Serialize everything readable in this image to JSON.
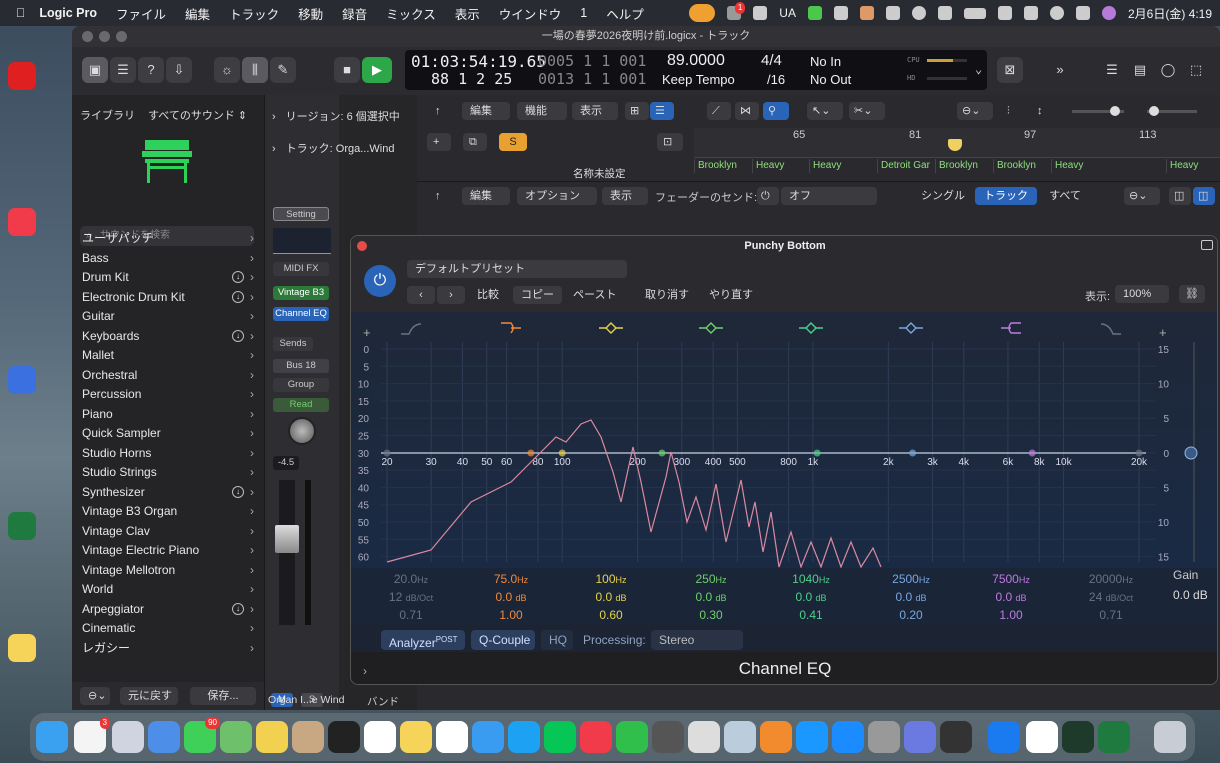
{
  "menubar": {
    "app": "Logic Pro",
    "items": [
      "ファイル",
      "編集",
      "トラック",
      "移動",
      "録音",
      "ミックス",
      "表示",
      "ウインドウ",
      "1",
      "ヘルプ"
    ],
    "ua": "UA",
    "datetime": "2月6日(金)  4:19",
    "notif_badge": "1"
  },
  "window": {
    "title": "一場の春夢2026夜明け前.logicx - トラック"
  },
  "lcd": {
    "smpte": "01:03:54:19.65",
    "bars_top": "0005  1  1  001",
    "tempo": "89.0000",
    "signature": "4/4",
    "in": "No In",
    "bars": "88  1  2  25",
    "bars_bottom": "0013  1  1  001",
    "tempo_mode": "Keep Tempo",
    "division": "/16",
    "out": "No Out",
    "cpu": "CPU",
    "hd": "HD"
  },
  "library": {
    "title": "ライブラリ",
    "filter": "すべてのサウンド ⇕",
    "search_placeholder": "サウンドを検索",
    "items": [
      {
        "label": "ユーザパッチ",
        "dl": false
      },
      {
        "label": "Bass",
        "dl": false
      },
      {
        "label": "Drum Kit",
        "dl": true
      },
      {
        "label": "Electronic Drum Kit",
        "dl": true
      },
      {
        "label": "Guitar",
        "dl": false
      },
      {
        "label": "Keyboards",
        "dl": true
      },
      {
        "label": "Mallet",
        "dl": false
      },
      {
        "label": "Orchestral",
        "dl": false
      },
      {
        "label": "Percussion",
        "dl": false
      },
      {
        "label": "Piano",
        "dl": false
      },
      {
        "label": "Quick Sampler",
        "dl": false
      },
      {
        "label": "Studio Horns",
        "dl": false
      },
      {
        "label": "Studio Strings",
        "dl": false
      },
      {
        "label": "Synthesizer",
        "dl": true
      },
      {
        "label": "Vintage B3 Organ",
        "dl": false
      },
      {
        "label": "Vintage Clav",
        "dl": false
      },
      {
        "label": "Vintage Electric Piano",
        "dl": false
      },
      {
        "label": "Vintage Mellotron",
        "dl": false
      },
      {
        "label": "World",
        "dl": false
      },
      {
        "label": "Arpeggiator",
        "dl": true
      },
      {
        "label": "Cinematic",
        "dl": false
      },
      {
        "label": "レガシー",
        "dl": false
      }
    ],
    "revert": "元に戻す",
    "save": "保存..."
  },
  "inspector": {
    "region": "リージョン: 6 個選択中",
    "track": "トラック:  Orga...Wind"
  },
  "strip": {
    "setting": "Setting",
    "midifx": "MIDI FX",
    "inst": "Vintage B3",
    "eq": "Channel EQ",
    "sends": "Sends",
    "bus": "Bus 18",
    "group": "Group",
    "read": "Read",
    "pan_value": "-4.5",
    "m": "M",
    "s": "S",
    "name": "Organ I...e Wind",
    "next": "バンド"
  },
  "tracks": {
    "edit": "編集",
    "func": "機能",
    "view": "表示",
    "s_btn": "S",
    "ruler": [
      "65",
      "81",
      "97",
      "113"
    ],
    "unnamed": "名称未設定",
    "regions": [
      {
        "label": "Brooklyn",
        "color": "#6fae4a"
      },
      {
        "label": "Heavy",
        "color": "#6fae4a"
      },
      {
        "label": "Heavy",
        "color": "#6fae4a"
      },
      {
        "label": "Detroit Gar",
        "color": "#6fae4a"
      },
      {
        "label": "Brooklyn",
        "color": "#6fae4a"
      },
      {
        "label": "Brooklyn",
        "color": "#6fae4a"
      },
      {
        "label": "Heavy",
        "color": "#6fae4a"
      },
      {
        "label": "Heavy",
        "color": "#6fae4a"
      }
    ]
  },
  "mixerhdr": {
    "edit": "編集",
    "options": "オプション",
    "view": "表示",
    "fader_send": "フェーダーのセンド:",
    "off": "オフ",
    "single": "シングル",
    "track": "トラック",
    "all": "すべて"
  },
  "plugin": {
    "title": "Punchy Bottom",
    "preset": "デフォルトプリセット",
    "compare": "比較",
    "copy": "コピー",
    "paste": "ペースト",
    "undo": "取り消す",
    "redo": "やり直す",
    "zoom_label": "表示:",
    "zoom": "100%",
    "db_left": [
      "0",
      "5",
      "10",
      "15",
      "20",
      "25",
      "30",
      "35",
      "40",
      "45",
      "50",
      "55",
      "60"
    ],
    "db_right": [
      "15",
      "10",
      "5",
      "0",
      "5",
      "10",
      "15"
    ],
    "freq_ticks": [
      "20",
      "30",
      "40",
      "50",
      "60",
      "80",
      "100",
      "200",
      "300",
      "400",
      "500",
      "800",
      "1k",
      "2k",
      "3k",
      "4k",
      "6k",
      "8k",
      "10k",
      "20k"
    ],
    "bands": [
      {
        "freq": "20.0",
        "unit": "Hz",
        "gain": "12",
        "gunit": "dB/Oct",
        "q": "0.71",
        "color": "#6a7282"
      },
      {
        "freq": "75.0",
        "unit": "Hz",
        "gain": "0.0",
        "gunit": "dB",
        "q": "1.00",
        "color": "#f08a3c"
      },
      {
        "freq": "100",
        "unit": "Hz",
        "gain": "0.0",
        "gunit": "dB",
        "q": "0.60",
        "color": "#e6d24a"
      },
      {
        "freq": "250",
        "unit": "Hz",
        "gain": "0.0",
        "gunit": "dB",
        "q": "0.30",
        "color": "#6fd06a"
      },
      {
        "freq": "1040",
        "unit": "Hz",
        "gain": "0.0",
        "gunit": "dB",
        "q": "0.41",
        "color": "#4ed08a"
      },
      {
        "freq": "2500",
        "unit": "Hz",
        "gain": "0.0",
        "gunit": "dB",
        "q": "0.20",
        "color": "#7aa6e0"
      },
      {
        "freq": "7500",
        "unit": "Hz",
        "gain": "0.0",
        "gunit": "dB",
        "q": "1.00",
        "color": "#c07ae0"
      },
      {
        "freq": "20000",
        "unit": "Hz",
        "gain": "24",
        "gunit": "dB/Oct",
        "q": "0.71",
        "color": "#6a7282"
      }
    ],
    "gain_label": "Gain",
    "gain_value": "0.0 dB",
    "analyzer": "Analyzer",
    "analyzer_sup": "POST",
    "qcouple": "Q-Couple",
    "hq": "HQ",
    "processing": "Processing:",
    "processing_value": "Stereo",
    "name": "Channel EQ"
  },
  "dock_badges": {
    "reminders": "3",
    "messages": "90"
  }
}
